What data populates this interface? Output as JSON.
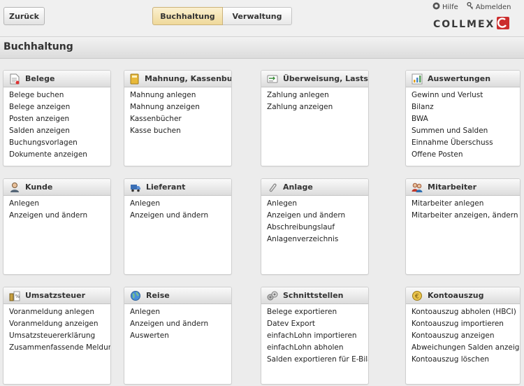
{
  "topbar": {
    "back_label": "Zurück",
    "tabs": [
      {
        "label": "Buchhaltung",
        "active": true
      },
      {
        "label": "Verwaltung",
        "active": false
      }
    ],
    "help_label": "Hilfe",
    "logout_label": "Abmelden",
    "logo_text": "COLLMEX",
    "brand_color": "#cc2d2d"
  },
  "page": {
    "title": "Buchhaltung"
  },
  "panels": [
    {
      "title": "Belege",
      "icon": "document-icon",
      "items": [
        "Belege buchen",
        "Belege anzeigen",
        "Posten anzeigen",
        "Salden anzeigen",
        "Buchungsvorlagen",
        "Dokumente anzeigen"
      ]
    },
    {
      "title": "Mahnung, Kassenbuch",
      "icon": "folder-icon",
      "items": [
        "Mahnung anlegen",
        "Mahnung anzeigen",
        "Kassenbücher",
        "Kasse buchen"
      ]
    },
    {
      "title": "Überweisung, Lastschrift",
      "icon": "transfer-icon",
      "items": [
        "Zahlung anlegen",
        "Zahlung anzeigen"
      ]
    },
    {
      "title": "Auswertungen",
      "icon": "report-icon",
      "items": [
        "Gewinn und Verlust",
        "Bilanz",
        "BWA",
        "Summen und Salden",
        "Einnahme Überschuss",
        "Offene Posten"
      ]
    },
    {
      "title": "Kunde",
      "icon": "customer-icon",
      "items": [
        "Anlegen",
        "Anzeigen und ändern"
      ]
    },
    {
      "title": "Lieferant",
      "icon": "truck-icon",
      "items": [
        "Anlegen",
        "Anzeigen und ändern"
      ]
    },
    {
      "title": "Anlage",
      "icon": "paperclip-icon",
      "items": [
        "Anlegen",
        "Anzeigen und ändern",
        "Abschreibungslauf",
        "Anlagenverzeichnis"
      ]
    },
    {
      "title": "Mitarbeiter",
      "icon": "employees-icon",
      "items": [
        "Mitarbeiter anlegen",
        "Mitarbeiter anzeigen, ändern"
      ]
    },
    {
      "title": "Umsatzsteuer",
      "icon": "tax-icon",
      "items": [
        "Voranmeldung anlegen",
        "Voranmeldung anzeigen",
        "Umsatzsteuererklärung",
        "Zusammenfassende Meldung"
      ]
    },
    {
      "title": "Reise",
      "icon": "globe-icon",
      "items": [
        "Anlegen",
        "Anzeigen und ändern",
        "Auswerten"
      ]
    },
    {
      "title": "Schnittstellen",
      "icon": "interface-icon",
      "items": [
        "Belege exportieren",
        "Datev Export",
        "einfachLohn importieren",
        "einfachLohn abholen",
        "Salden exportieren für E-Bilanz"
      ]
    },
    {
      "title": "Kontoauszug",
      "icon": "coin-icon",
      "items": [
        "Kontoauszug abholen (HBCI)",
        "Kontoauszug importieren",
        "Kontoauszug anzeigen",
        "Abweichungen Salden anzeigen",
        "Kontoauszug löschen"
      ]
    }
  ]
}
